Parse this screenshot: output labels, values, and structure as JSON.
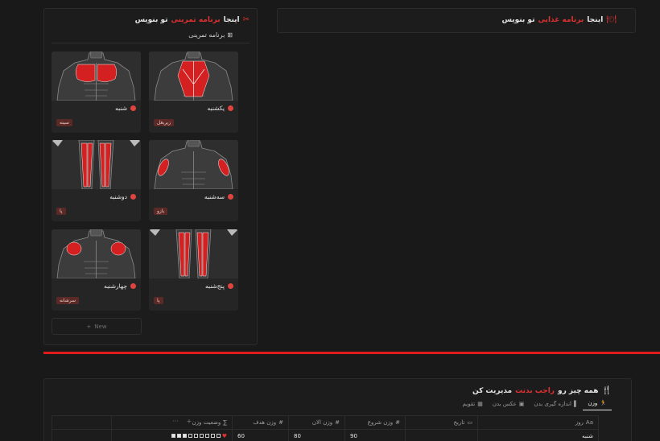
{
  "workout_panel": {
    "heading_prefix": "اینجا",
    "heading_accent": "برنامه تمرینی",
    "heading_suffix": "تو بنویس",
    "heading_icon": "✂",
    "view_label": "برنامه تمرینی",
    "view_icon": "⊞",
    "cards": [
      {
        "day": "یکشنبه",
        "tag": "زیربغل",
        "figure": "back"
      },
      {
        "day": "شنبه",
        "tag": "سینه",
        "figure": "chest"
      },
      {
        "day": "سه‌شنبه",
        "tag": "بازو",
        "figure": "arms"
      },
      {
        "day": "دوشنبه",
        "tag": "پا",
        "figure": "legs"
      },
      {
        "day": "پنج‌شنبه",
        "tag": "پا",
        "figure": "legs"
      },
      {
        "day": "چهارشنبه",
        "tag": "سرشانه",
        "figure": "shoulders"
      }
    ],
    "new_label": "New",
    "new_icon": "+"
  },
  "food_panel": {
    "heading_prefix": "اینجا",
    "heading_accent": "برنامه غذایی",
    "heading_suffix": "تو بنویس",
    "heading_icon": "🍽"
  },
  "manage_panel": {
    "heading_prefix": "همه چیز رو",
    "heading_accent": "راجب بدنت",
    "heading_suffix": "مدیریت کن",
    "heading_icon": "🍴",
    "tabs": [
      {
        "label": "وزن",
        "icon": "🏃",
        "active": true
      },
      {
        "label": "اندازه گیری بدن",
        "icon": "▌",
        "active": false
      },
      {
        "label": "عکس بدن",
        "icon": "▣",
        "active": false
      },
      {
        "label": "تقویم",
        "icon": "▦",
        "active": false
      }
    ],
    "columns": [
      {
        "label": "روز",
        "icon": "Aa"
      },
      {
        "label": "تاریخ",
        "icon": "▭"
      },
      {
        "label": "وزن شروع",
        "icon": "#"
      },
      {
        "label": "وزن الان",
        "icon": "#"
      },
      {
        "label": "وزن هدف",
        "icon": "#"
      },
      {
        "label": "وضعیت وزن",
        "icon": "∑"
      }
    ],
    "toolbar": {
      "add": "+",
      "more": "···"
    },
    "rows": [
      {
        "day": "شنبه",
        "date": "",
        "start": "90",
        "now": "80",
        "goal": "60",
        "progress_filled": 3,
        "progress_total": 9
      }
    ]
  },
  "colors": {
    "accent": "#e03131",
    "divider": "#e01b1b",
    "muscle": "#d42020",
    "background": "#191919"
  }
}
